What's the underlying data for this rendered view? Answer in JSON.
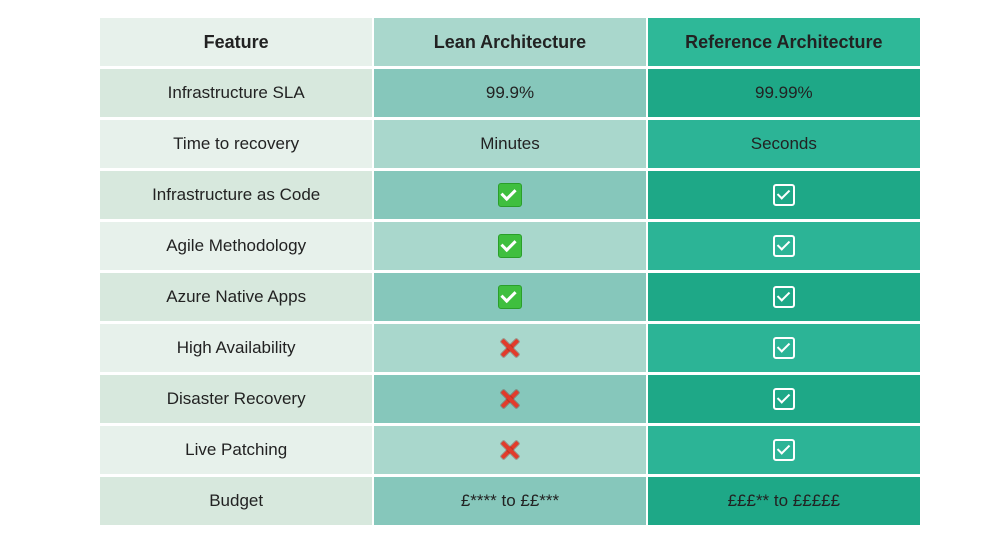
{
  "chart_data": {
    "type": "table",
    "columns": [
      "Feature",
      "Lean Architecture",
      "Reference Architecture"
    ],
    "rows": [
      {
        "feature": "Infrastructure SLA",
        "lean": "99.9%",
        "ref": "99.99%"
      },
      {
        "feature": "Time to recovery",
        "lean": "Minutes",
        "ref": "Seconds"
      },
      {
        "feature": "Infrastructure as Code",
        "lean": true,
        "ref": true
      },
      {
        "feature": "Agile Methodology",
        "lean": true,
        "ref": true
      },
      {
        "feature": "Azure Native Apps",
        "lean": true,
        "ref": true
      },
      {
        "feature": "High Availability",
        "lean": false,
        "ref": true
      },
      {
        "feature": "Disaster Recovery",
        "lean": false,
        "ref": true
      },
      {
        "feature": "Live Patching",
        "lean": false,
        "ref": true
      },
      {
        "feature": "Budget",
        "lean": "£**** to ££***",
        "ref": "£££** to £££££"
      }
    ]
  },
  "icon_styles": {
    "lean_true": "check-green",
    "lean_false": "cross-red",
    "ref_true": "check-outline",
    "ref_false": "cross-red"
  }
}
